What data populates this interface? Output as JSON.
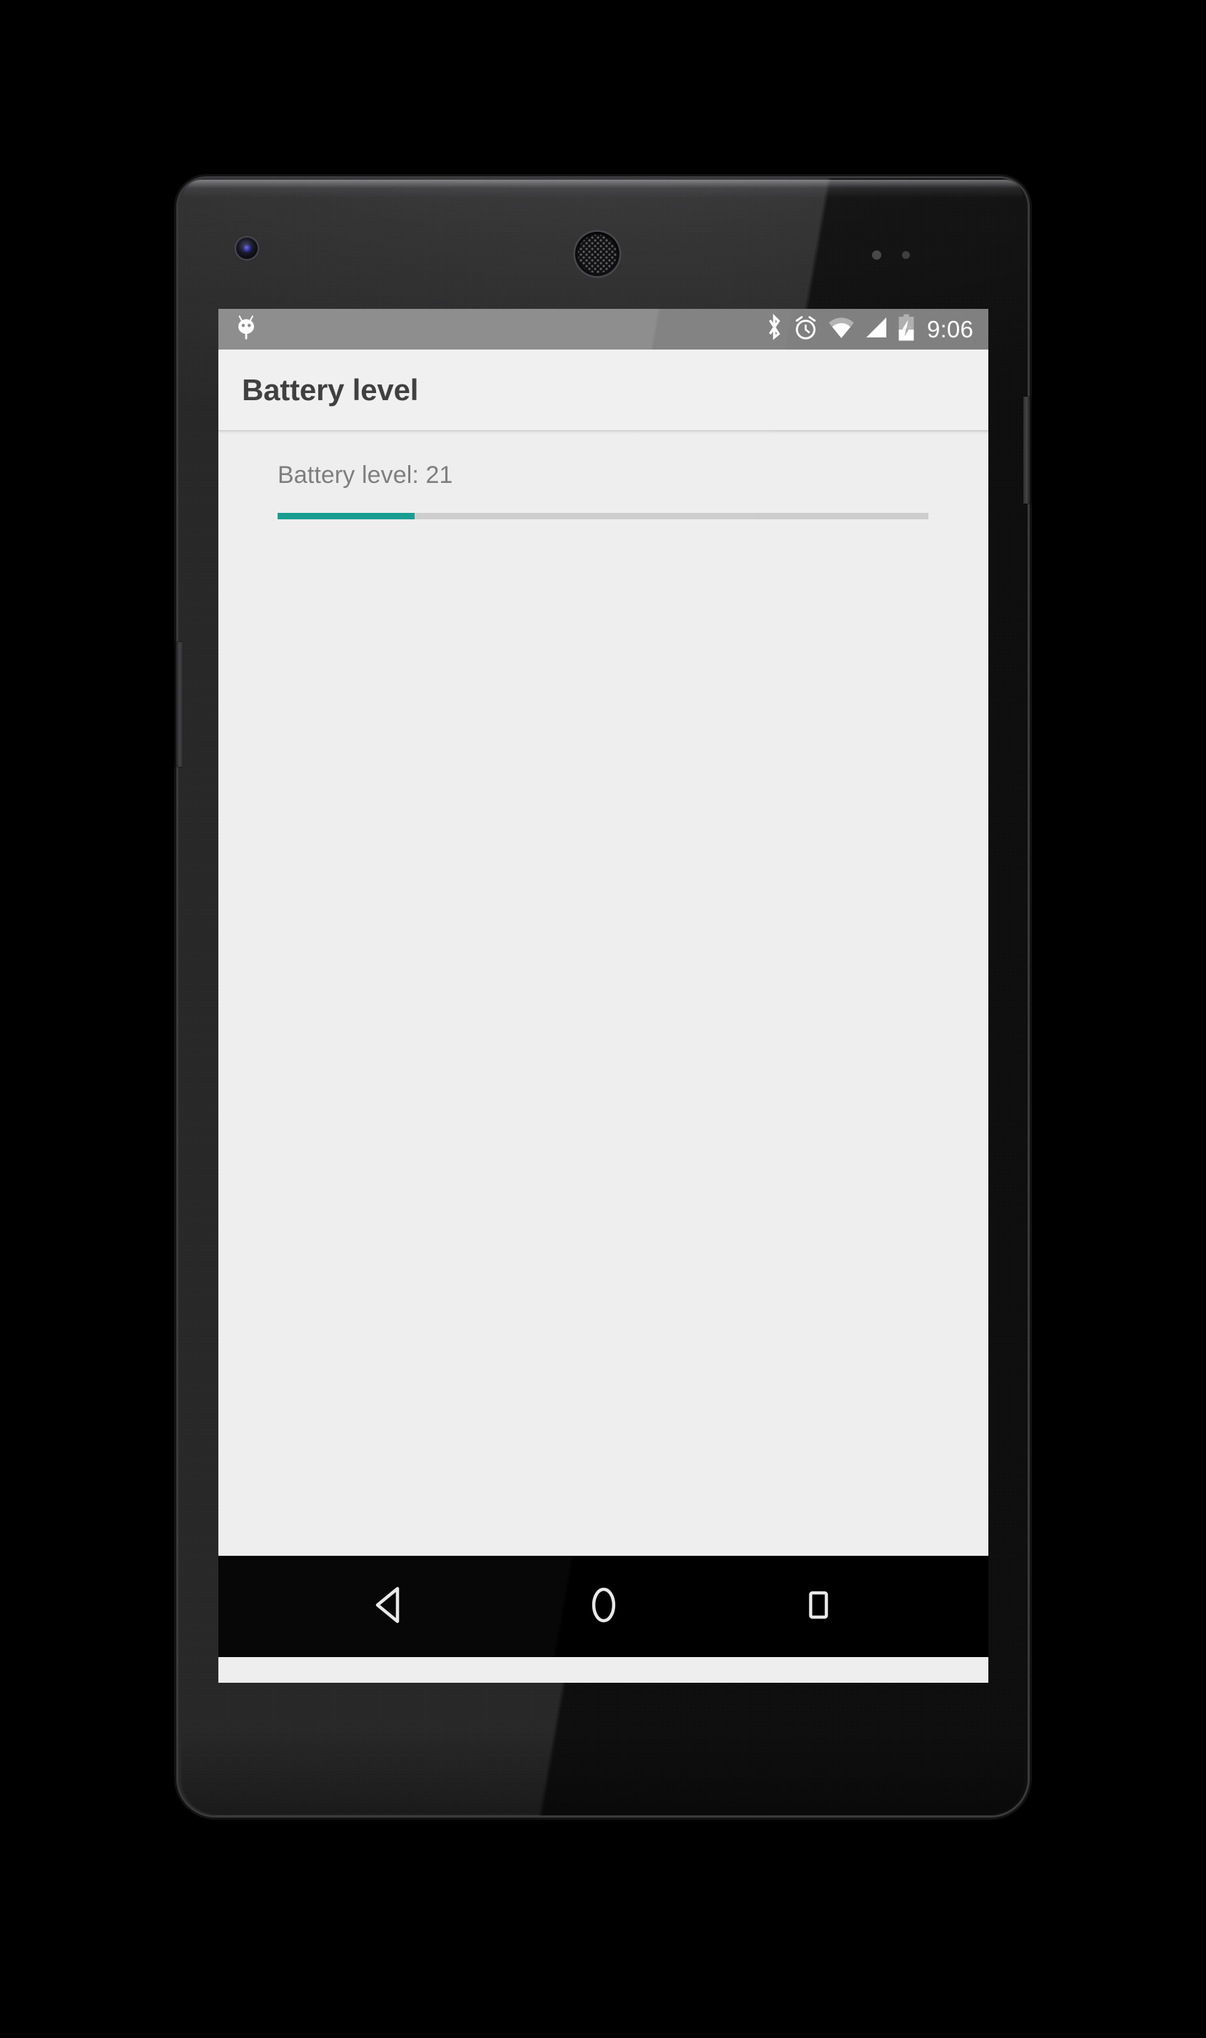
{
  "device": {
    "model_frame": "nexus-5",
    "hardware": {
      "front_camera": "front-camera",
      "earpiece": "earpiece-speaker",
      "proximity_sensor": "proximity-sensor",
      "light_sensor": "light-sensor",
      "power_button": "power-button",
      "volume_rocker": "volume-rocker"
    }
  },
  "status_bar": {
    "background_color": "#808080",
    "clock": "9:06",
    "notification_icons": [
      {
        "name": "android-bugdroid-icon",
        "label": "Android system notification"
      }
    ],
    "system_icons": [
      {
        "name": "bluetooth-icon",
        "label": "Bluetooth on"
      },
      {
        "name": "alarm-icon",
        "label": "Alarm set"
      },
      {
        "name": "wifi-icon",
        "label": "Wi-Fi signal"
      },
      {
        "name": "cellular-signal-icon",
        "label": "Cellular signal"
      },
      {
        "name": "battery-charging-icon",
        "label": "Battery charging"
      }
    ]
  },
  "app_bar": {
    "title": "Battery level",
    "background_color": "#f0f0f0",
    "title_color": "#3b3b3b"
  },
  "content": {
    "background_color": "#eeeeee",
    "battery_level_label": "Battery level: 21",
    "progress": {
      "value": 21,
      "min": 0,
      "max": 100,
      "fill_color": "#139a8e",
      "track_color": "#cdcdcd",
      "percent_css": "21%"
    }
  },
  "nav_bar": {
    "background_color": "#000000",
    "buttons": [
      {
        "name": "nav-back-button",
        "label": "Back"
      },
      {
        "name": "nav-home-button",
        "label": "Home"
      },
      {
        "name": "nav-recents-button",
        "label": "Recent apps"
      }
    ]
  }
}
